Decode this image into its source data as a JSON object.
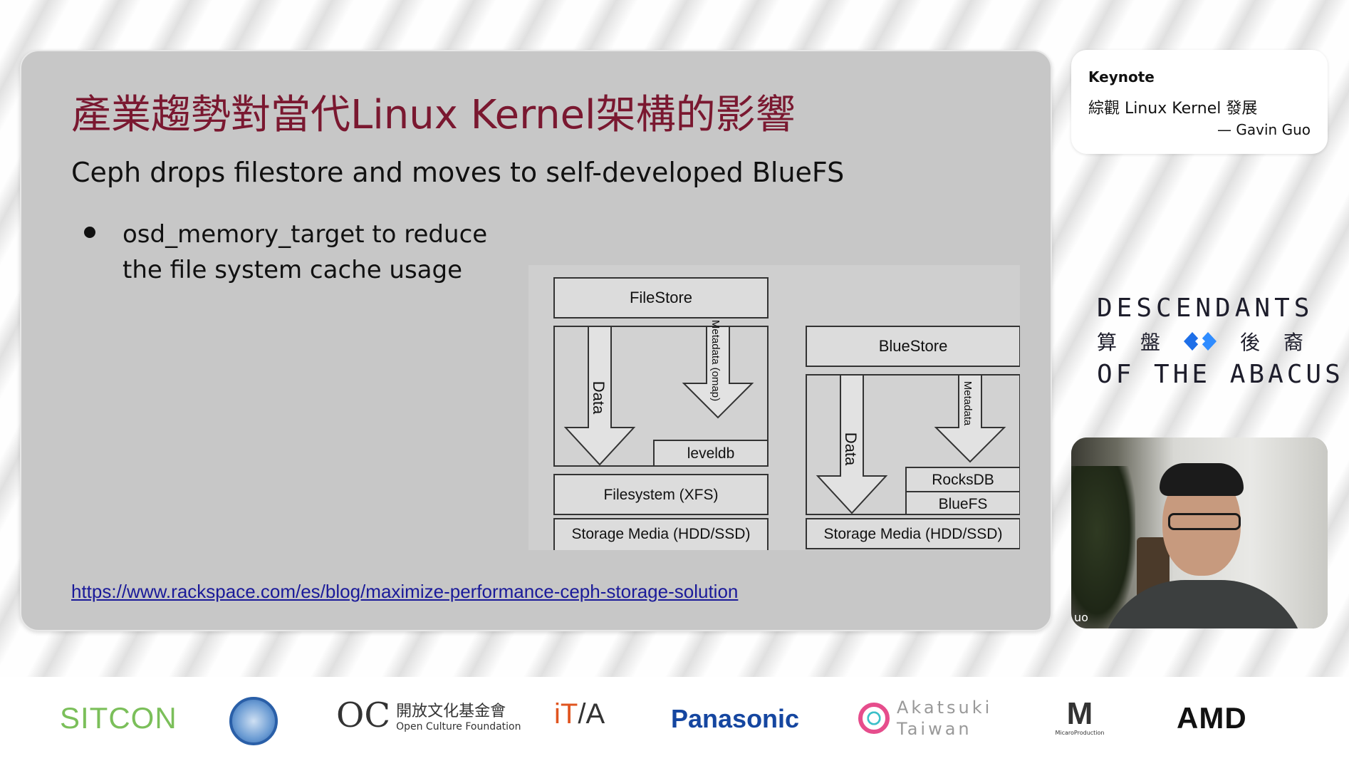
{
  "slide": {
    "title": "產業趨勢對當代Linux Kernel架構的影響",
    "subtitle": "Ceph drops filestore and moves to self-developed BlueFS",
    "bullet_line1": "osd_memory_target to reduce",
    "bullet_line2": "the file system cache usage",
    "link": "https://www.rackspace.com/es/blog/maximize-performance-ceph-storage-solution"
  },
  "diagram": {
    "filestore": {
      "title": "FileStore",
      "data_label": "Data",
      "metadata_label": "Metadata (omap)",
      "db_label": "leveldb",
      "filesystem_label": "Filesystem (XFS)",
      "media_label": "Storage Media (HDD/SSD)"
    },
    "bluestore": {
      "title": "BlueStore",
      "data_label": "Data",
      "metadata_label": "Metadata",
      "db_label": "RocksDB",
      "fs_label": "BlueFS",
      "media_label": "Storage Media (HDD/SSD)"
    }
  },
  "keynote": {
    "label": "Keynote",
    "title": "綜觀 Linux Kernel 發展",
    "speaker": "— Gavin Guo"
  },
  "brand": {
    "line1": "DESCENDANTS",
    "cjk": [
      "算",
      "盤",
      "後",
      "裔"
    ],
    "line3": "OF THE ABACUS"
  },
  "video": {
    "name_tag": "uo"
  },
  "sponsors": {
    "sitcon": "SITCON",
    "ocf_mark": "OC",
    "ocf_name": "開放文化基金會",
    "ocf_en": "Open Culture Foundation",
    "itsa_prefix": "iT",
    "itsa_suffix": "A",
    "panasonic": "Panasonic",
    "akatsuki_line1": "Akatsuki",
    "akatsuki_line2": "Taiwan",
    "micaro_sub": "MicaroProduction",
    "amd": "AMD"
  }
}
